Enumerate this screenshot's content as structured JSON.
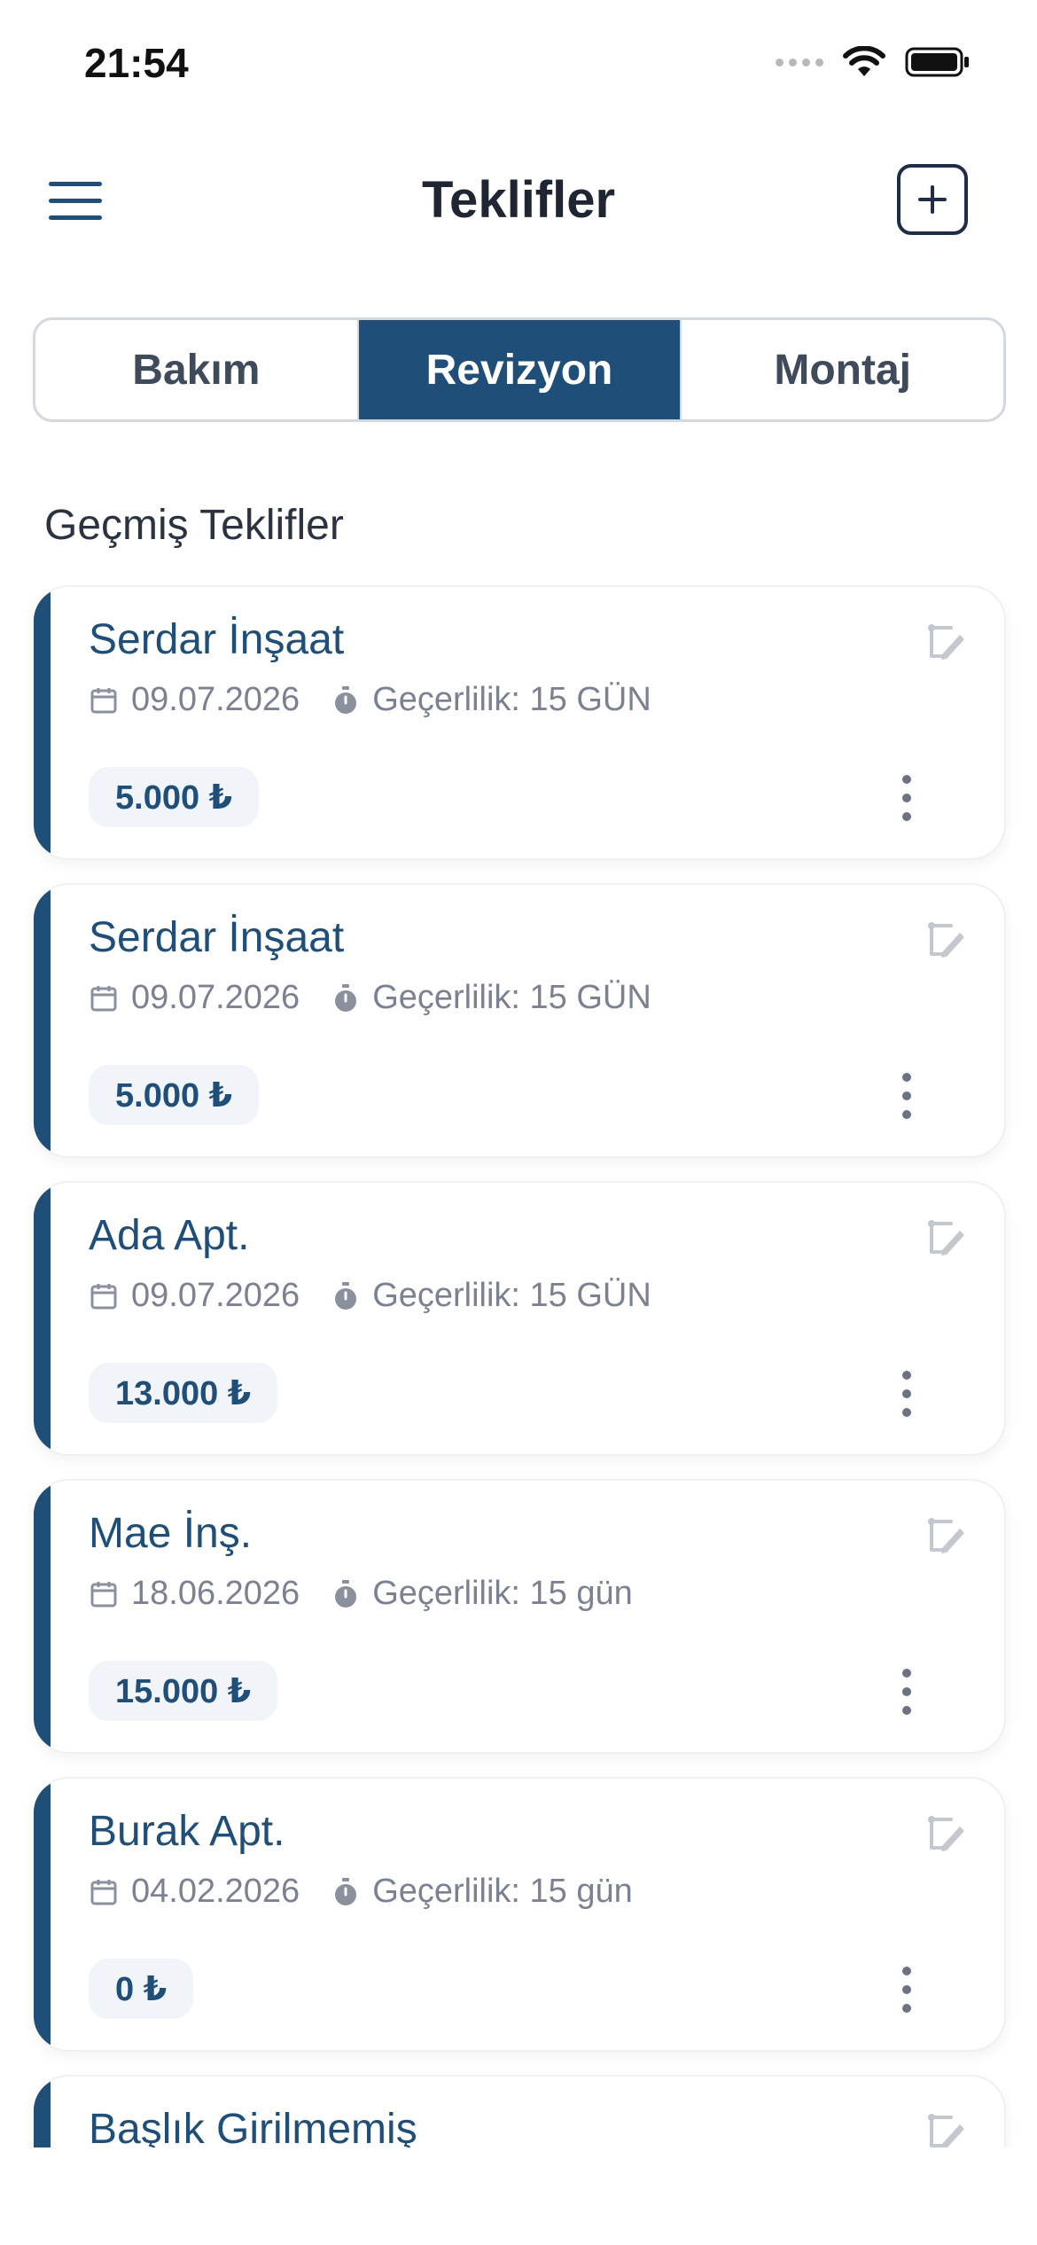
{
  "status_bar": {
    "time": "21:54"
  },
  "header": {
    "title": "Teklifler"
  },
  "tabs": [
    {
      "label": "Bakım",
      "active": false
    },
    {
      "label": "Revizyon",
      "active": true
    },
    {
      "label": "Montaj",
      "active": false
    }
  ],
  "section": {
    "title": "Geçmiş Teklifler"
  },
  "offers": [
    {
      "title": "Serdar İnşaat",
      "date": "09.07.2026",
      "validity": "Geçerlilik: 15 GÜN",
      "price": "5.000 ₺"
    },
    {
      "title": "Serdar İnşaat",
      "date": "09.07.2026",
      "validity": "Geçerlilik: 15 GÜN",
      "price": "5.000 ₺"
    },
    {
      "title": "Ada Apt.",
      "date": "09.07.2026",
      "validity": "Geçerlilik: 15 GÜN",
      "price": "13.000 ₺"
    },
    {
      "title": "Mae İnş.",
      "date": "18.06.2026",
      "validity": "Geçerlilik: 15 gün",
      "price": "15.000 ₺"
    },
    {
      "title": "Burak Apt.",
      "date": "04.02.2026",
      "validity": "Geçerlilik: 15 gün",
      "price": "0 ₺"
    },
    {
      "title": "Başlık Girilmemiş"
    }
  ],
  "icons": {
    "menu": "menu-icon",
    "add": "plus-square-icon",
    "date": "calendar-icon",
    "validity": "timer-icon",
    "edit": "edit-document-icon",
    "more": "more-vertical-icon"
  },
  "colors": {
    "primary": "#1f4e79",
    "text_muted": "#7b8190",
    "badge_bg": "#f1f5fa"
  }
}
